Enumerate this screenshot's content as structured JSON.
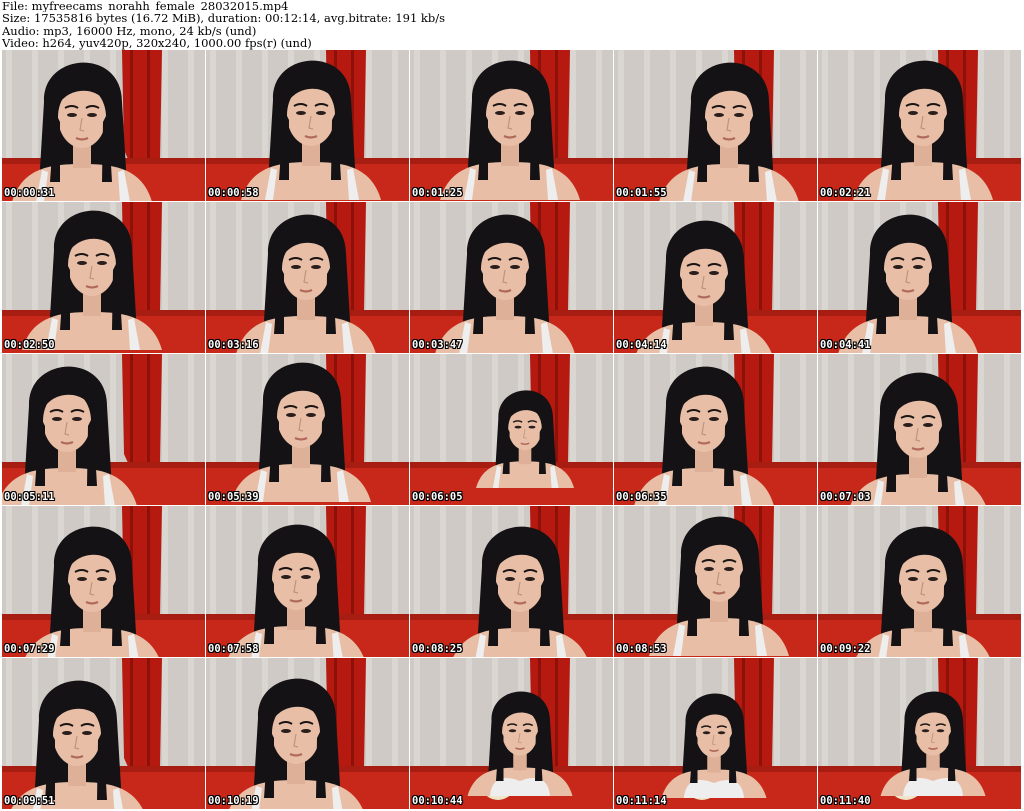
{
  "header": {
    "line1": "File: myfreecams_norahh_female_28032015.mp4",
    "line2": "Size: 17535816 bytes (16.72 MiB), duration: 00:12:14, avg.bitrate: 191 kb/s",
    "line3": "Audio: mp3, 16000 Hz, mono, 24 kb/s (und)",
    "line4": "Video: h264, yuv420p, 320x240, 1000.00 fps(r) (und)"
  },
  "thumbnails": [
    {
      "timestamp": "00:00:31"
    },
    {
      "timestamp": "00:00:58"
    },
    {
      "timestamp": "00:01:25"
    },
    {
      "timestamp": "00:01:55"
    },
    {
      "timestamp": "00:02:21"
    },
    {
      "timestamp": "00:02:50"
    },
    {
      "timestamp": "00:03:16"
    },
    {
      "timestamp": "00:03:47"
    },
    {
      "timestamp": "00:04:14"
    },
    {
      "timestamp": "00:04:41"
    },
    {
      "timestamp": "00:05:11"
    },
    {
      "timestamp": "00:05:39"
    },
    {
      "timestamp": "00:06:05"
    },
    {
      "timestamp": "00:06:35"
    },
    {
      "timestamp": "00:07:03"
    },
    {
      "timestamp": "00:07:29"
    },
    {
      "timestamp": "00:07:58"
    },
    {
      "timestamp": "00:08:25"
    },
    {
      "timestamp": "00:08:53"
    },
    {
      "timestamp": "00:09:22"
    },
    {
      "timestamp": "00:09:51"
    },
    {
      "timestamp": "00:10:19"
    },
    {
      "timestamp": "00:10:44"
    },
    {
      "timestamp": "00:11:14"
    },
    {
      "timestamp": "00:11:40"
    }
  ],
  "colors": {
    "wall": "#cfcac6",
    "curtain": "#b5190f",
    "couch": "#c7281a",
    "hair": "#141214",
    "skin": "#e8bfa6",
    "top": "#eeeeee"
  }
}
